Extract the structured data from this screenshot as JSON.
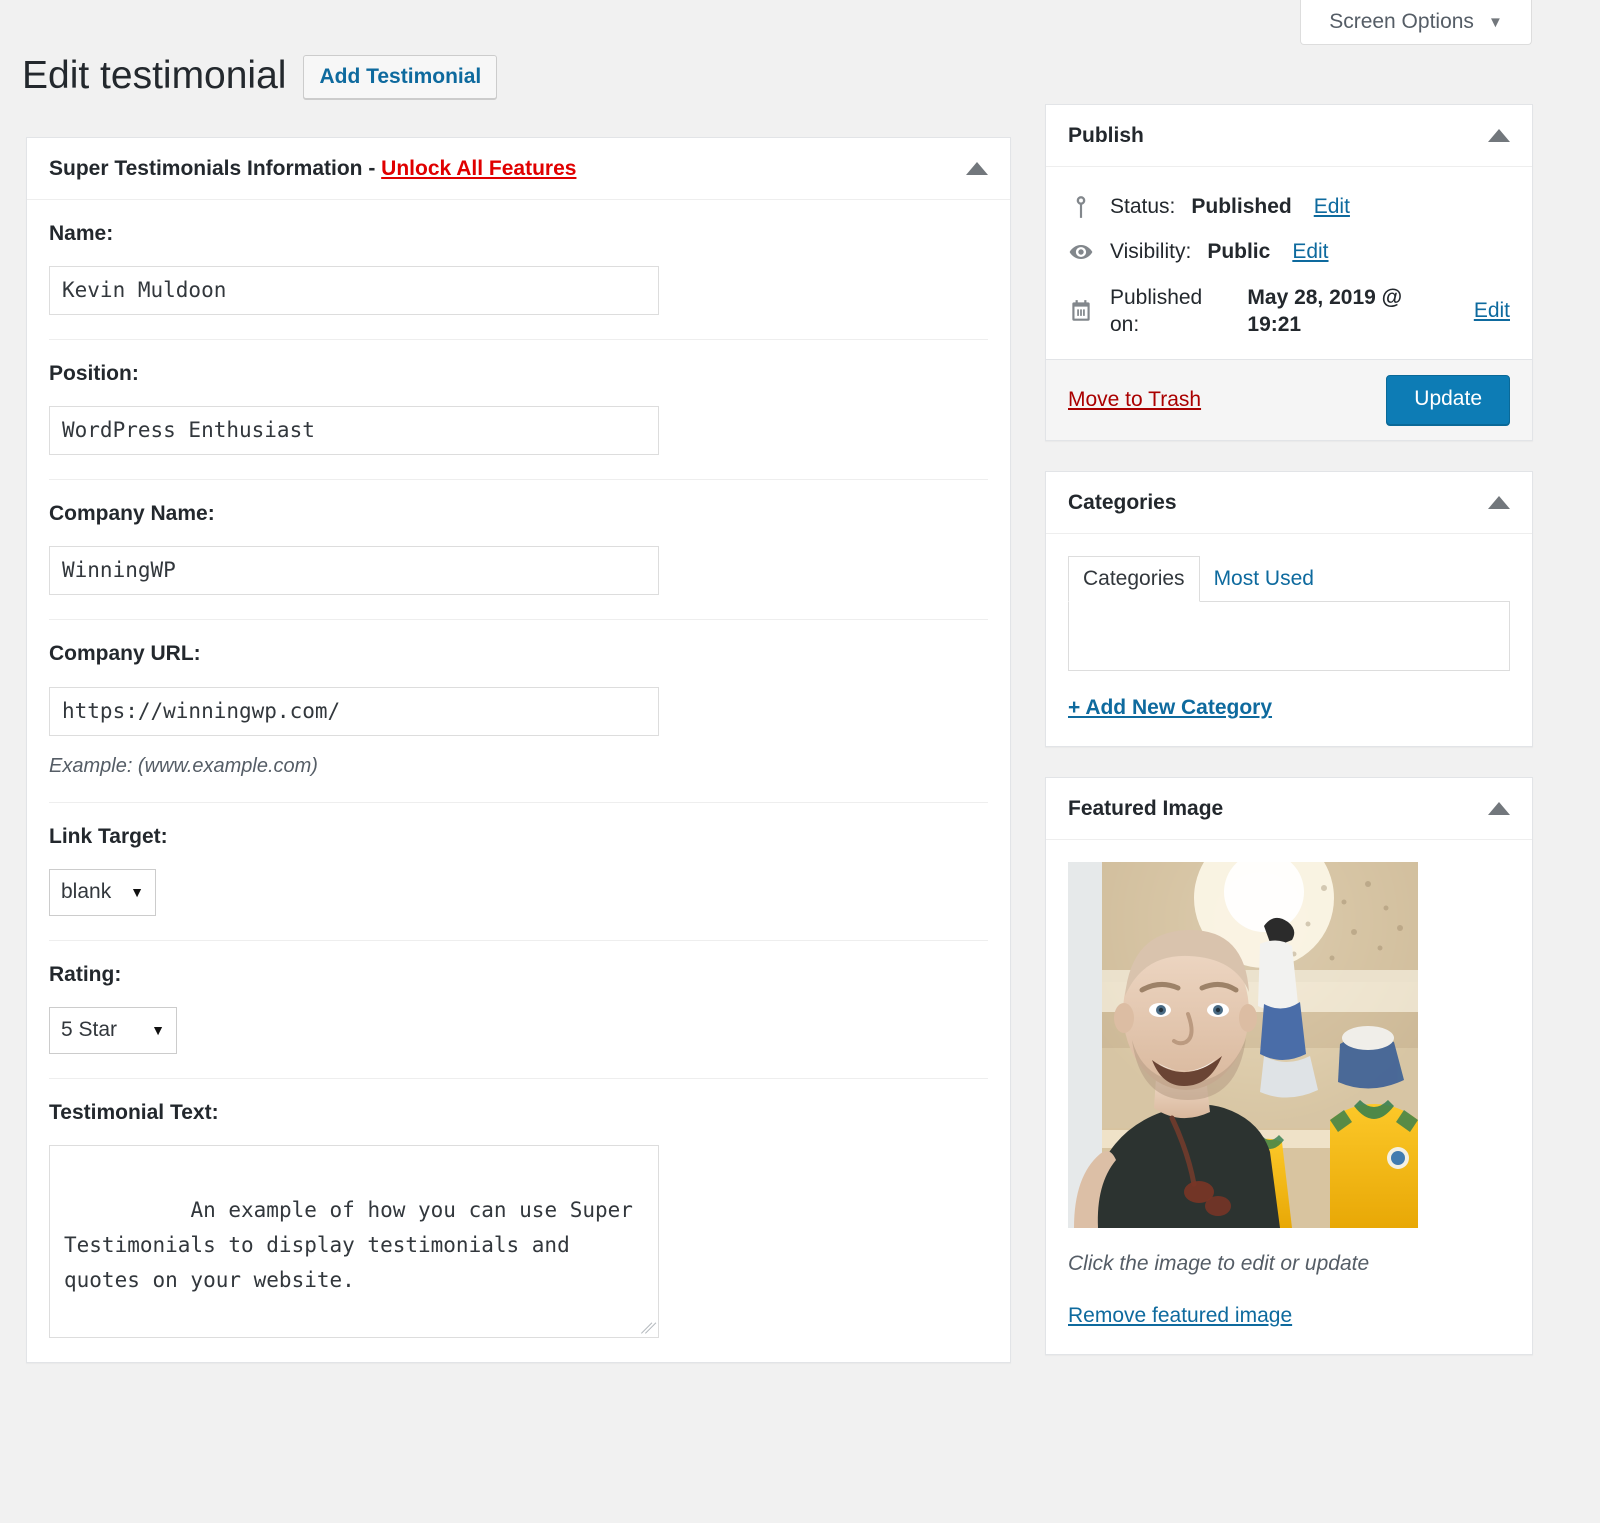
{
  "screen_options": {
    "label": "Screen Options",
    "caret": "▼"
  },
  "header": {
    "title": "Edit testimonial",
    "add_button": "Add Testimonial"
  },
  "testimonial_box": {
    "title": "Super Testimonials Information",
    "separator": "-",
    "unlock_link": "Unlock All Features",
    "fields": {
      "name_label": "Name:",
      "name_value": "Kevin Muldoon",
      "position_label": "Position:",
      "position_value": "WordPress Enthusiast",
      "company_label": "Company Name:",
      "company_value": "WinningWP",
      "url_label": "Company URL:",
      "url_value": "https://winningwp.com/",
      "url_help": "Example: (www.example.com)",
      "link_target_label": "Link Target:",
      "link_target_value": "blank",
      "rating_label": "Rating:",
      "rating_value": "5 Star",
      "text_label": "Testimonial Text:",
      "text_value": "An example of how you can use Super Testimonials to display testimonials and quotes on your website."
    }
  },
  "publish": {
    "title": "Publish",
    "status_label": "Status:",
    "status_value": "Published",
    "status_edit": "Edit",
    "visibility_label": "Visibility:",
    "visibility_value": "Public",
    "visibility_edit": "Edit",
    "published_label": "Published on:",
    "published_value": "May 28, 2019 @ 19:21",
    "published_edit": "Edit",
    "trash_label": "Move to Trash",
    "update_label": "Update"
  },
  "categories": {
    "title": "Categories",
    "tab_categories": "Categories",
    "tab_most_used": "Most Used",
    "add_new": "+ Add New Category"
  },
  "featured_image": {
    "title": "Featured Image",
    "caption": "Click the image to edit or update",
    "remove_label": "Remove featured image"
  },
  "colors": {
    "accent_blue": "#0e6a9e",
    "update_blue": "#0d7cb5",
    "danger_red": "#a00",
    "unlock_red": "#e00000",
    "page_bg": "#f1f1f1"
  }
}
